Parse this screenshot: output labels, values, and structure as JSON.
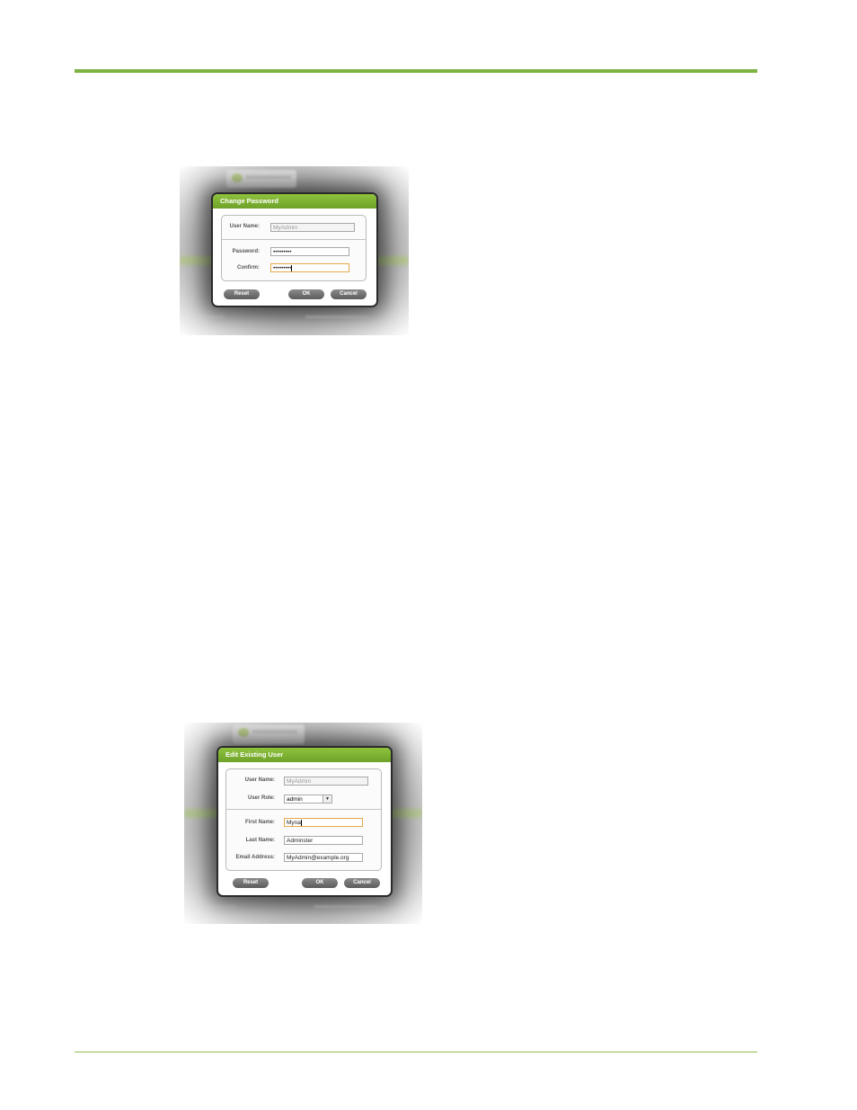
{
  "change_password": {
    "title": "Change Password",
    "user_name_label": "User Name:",
    "user_name_value": "MyAdmin",
    "password_label": "Password:",
    "password_value": "•••••••••",
    "confirm_label": "Confirm:",
    "confirm_value": "•••••••••",
    "reset_label": "Reset",
    "ok_label": "OK",
    "cancel_label": "Cancel"
  },
  "edit_user": {
    "title": "Edit Existing User",
    "user_name_label": "User Name:",
    "user_name_value": "MyAdmin",
    "user_role_label": "User Role:",
    "user_role_value": "admin",
    "first_name_label": "First Name:",
    "first_name_value": "Myna",
    "last_name_label": "Last Name:",
    "last_name_value": "Adminster",
    "email_label": "Email Address:",
    "email_value": "MyAdmin@example.org",
    "reset_label": "Reset",
    "ok_label": "OK",
    "cancel_label": "Cancel"
  },
  "colors": {
    "accent_green": "#7cb342",
    "button_gray": "#6a6a6a"
  }
}
